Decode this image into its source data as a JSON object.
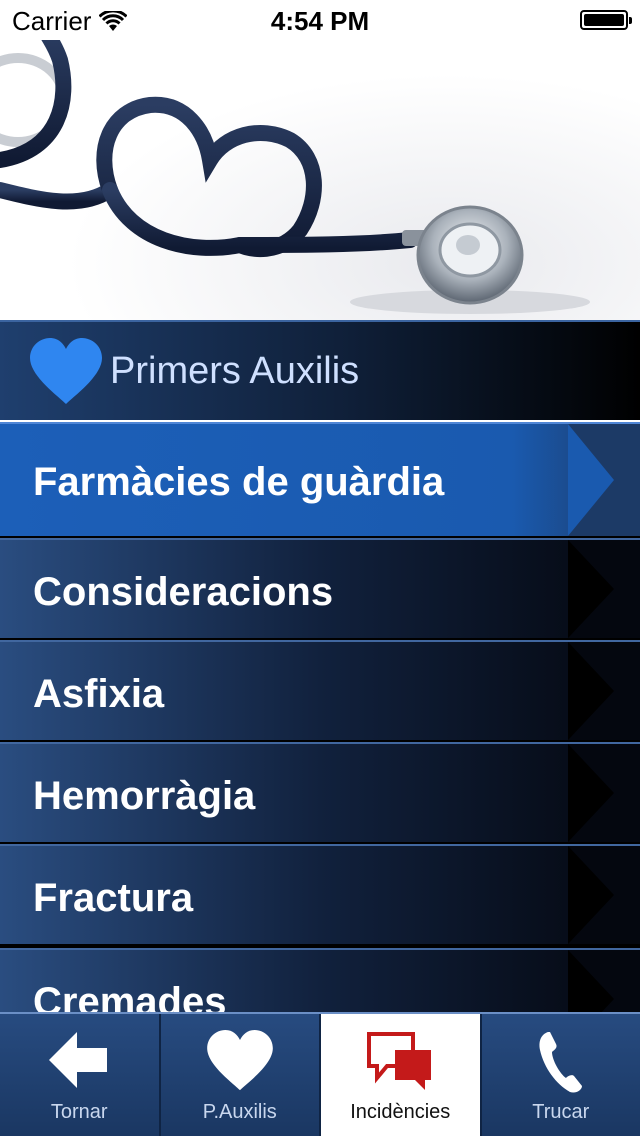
{
  "status_bar": {
    "carrier": "Carrier",
    "time": "4:54 PM"
  },
  "hero": {
    "image": "stethoscope-heart-image"
  },
  "header": {
    "title": "Primers Auxilis",
    "icon": "heart-icon"
  },
  "menu": {
    "items": [
      {
        "label": "Farmàcies de guàrdia",
        "active": true
      },
      {
        "label": "Consideracions",
        "active": false
      },
      {
        "label": "Asfixia",
        "active": false
      },
      {
        "label": "Hemorràgia",
        "active": false
      },
      {
        "label": "Fractura",
        "active": false
      },
      {
        "label": "Cremades",
        "active": false
      }
    ]
  },
  "tabbar": {
    "tabs": [
      {
        "label": "Tornar",
        "icon": "back-arrow-icon",
        "active": false
      },
      {
        "label": "P.Auxilis",
        "icon": "heart-icon",
        "active": false
      },
      {
        "label": "Incidències",
        "icon": "chat-bubbles-icon",
        "active": true
      },
      {
        "label": "Trucar",
        "icon": "phone-icon",
        "active": false
      }
    ]
  },
  "colors": {
    "accent_blue": "#1a5aaf",
    "header_dark": "#0f1f38",
    "heart_blue": "#2f86f0",
    "incidencies_red": "#c41a1a"
  }
}
